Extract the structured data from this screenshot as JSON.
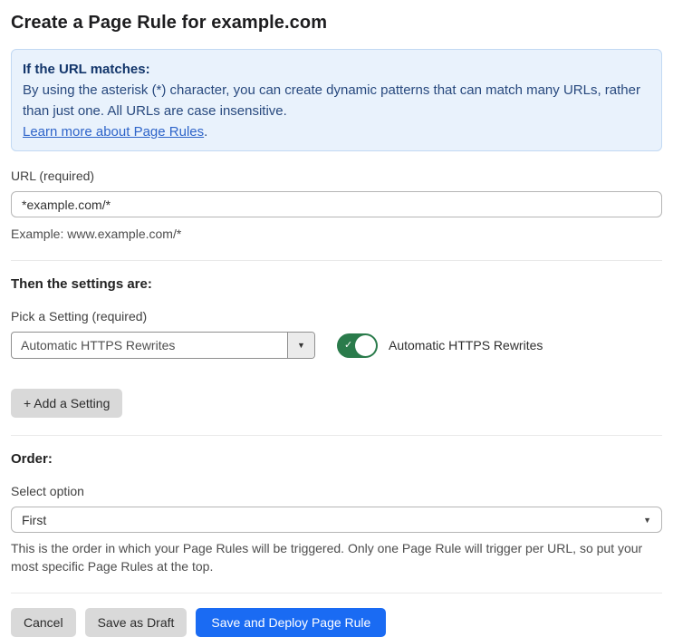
{
  "page": {
    "title": "Create a Page Rule for example.com"
  },
  "info_box": {
    "heading": "If the URL matches:",
    "body": "By using the asterisk (*) character, you can create dynamic patterns that can match many URLs, rather than just one. All URLs are case insensitive.",
    "link_text": "Learn more about Page Rules",
    "link_suffix": "."
  },
  "url_field": {
    "label": "URL (required)",
    "value": "*example.com/*",
    "helper": "Example: www.example.com/*"
  },
  "settings_section": {
    "heading": "Then the settings are:",
    "picker_label": "Pick a Setting (required)",
    "picker_value": "Automatic HTTPS Rewrites",
    "toggle_state": "on",
    "toggle_label": "Automatic HTTPS Rewrites",
    "add_setting_label": "+ Add a Setting"
  },
  "order_section": {
    "heading": "Order:",
    "select_label": "Select option",
    "select_value": "First",
    "helper": "This is the order in which your Page Rules will be triggered. Only one Page Rule will trigger per URL, so put your most specific Page Rules at the top."
  },
  "footer": {
    "cancel_label": "Cancel",
    "save_draft_label": "Save as Draft",
    "save_deploy_label": "Save and Deploy Page Rule"
  },
  "icons": {
    "caret_down": "▼",
    "check": "✓"
  },
  "colors": {
    "accent_blue": "#1a6bf3",
    "toggle_green": "#2a7b4b",
    "info_bg": "#e9f2fc",
    "info_border": "#c2d9f3",
    "info_heading_text": "#13366b",
    "info_body_text": "#28497e",
    "link_blue": "#2e64c9",
    "gray_button_bg": "#d9d9d9"
  }
}
